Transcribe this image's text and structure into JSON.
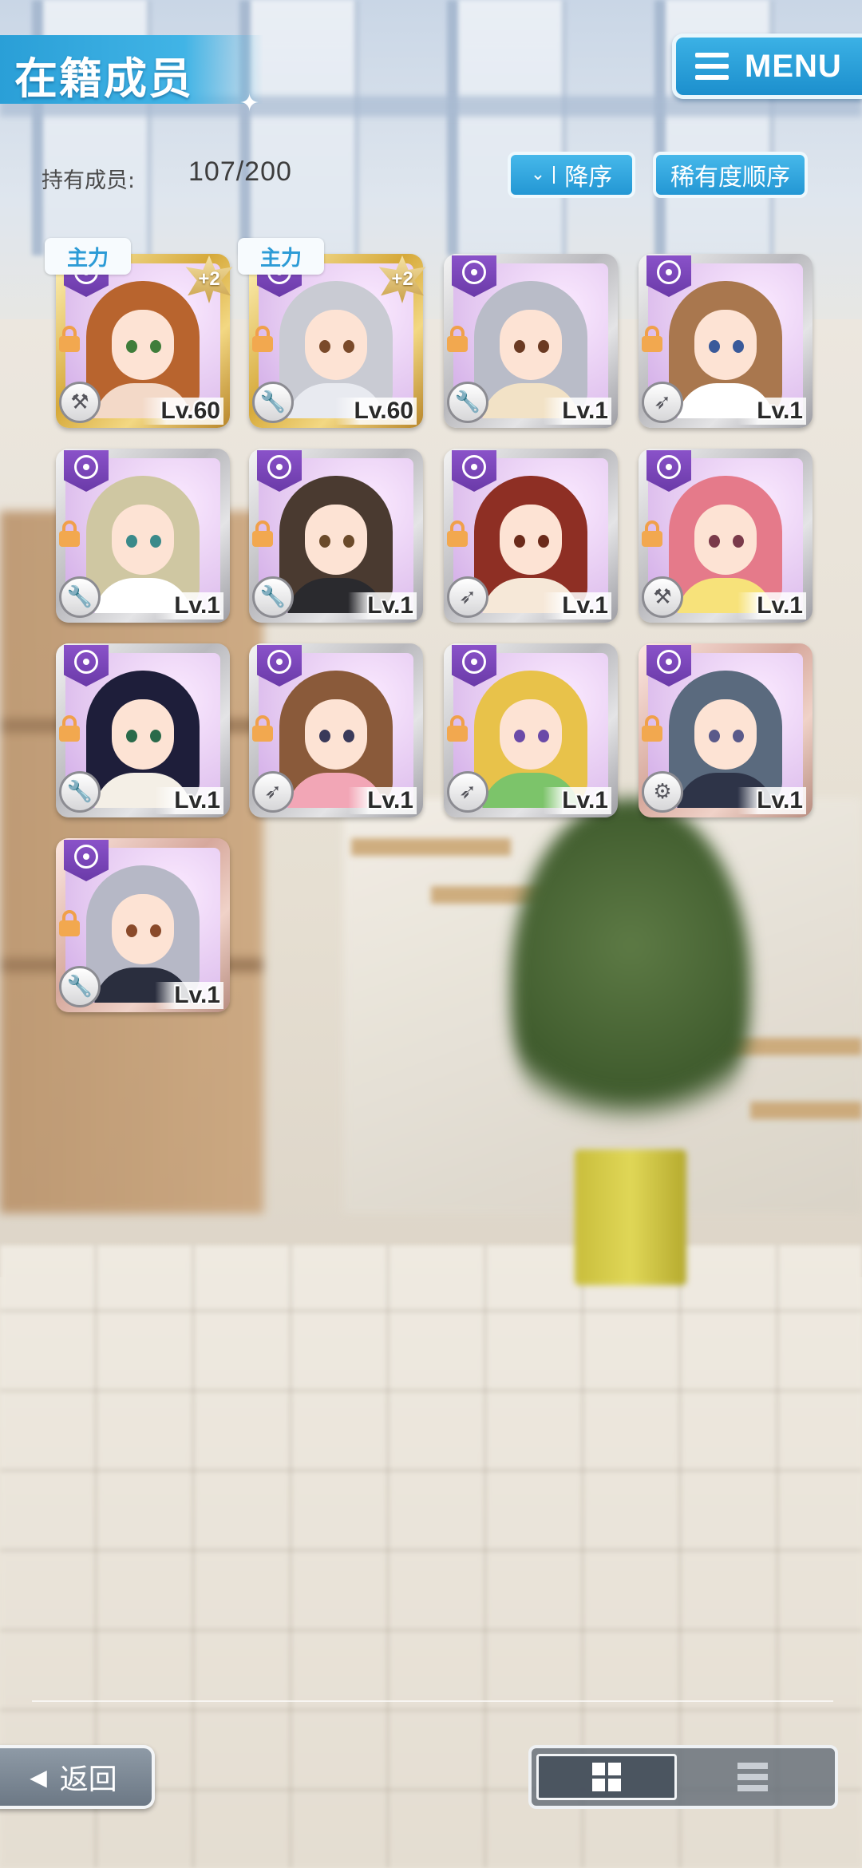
{
  "header": {
    "title": "在籍成员",
    "menu_label": "MENU",
    "menu_icon": "hamburger-icon"
  },
  "member_count": {
    "label": "持有成员:",
    "value": "107/200"
  },
  "sort": {
    "order_label": "降序",
    "order_icon": "double-chevron-down-icon",
    "rarity_label": "稀有度顺序"
  },
  "colors": {
    "accent_blue": "#2a9fd7",
    "attribute_purple": "#7a44b8",
    "lock_orange": "#f2a84f"
  },
  "members": [
    {
      "level": "Lv.60",
      "tag": "主力",
      "plus": "+2",
      "frame": "gold",
      "type_icon": "hammer-icon",
      "hair": "#b8642e",
      "body": "#f3d9c8",
      "eye": "#3f7d3a"
    },
    {
      "level": "Lv.60",
      "tag": "主力",
      "plus": "+2",
      "frame": "gold",
      "type_icon": "wrench-icon",
      "hair": "#c9cbd3",
      "body": "#e8eaf0",
      "eye": "#7a4a2a"
    },
    {
      "level": "Lv.1",
      "tag": "",
      "plus": "",
      "frame": "silver",
      "type_icon": "wrench-icon",
      "hair": "#b9bcc8",
      "body": "#f2e2c6",
      "eye": "#6b3a22"
    },
    {
      "level": "Lv.1",
      "tag": "",
      "plus": "",
      "frame": "silver",
      "type_icon": "rocket-icon",
      "hair": "#a9774e",
      "body": "#ffffff",
      "eye": "#3a5a9a"
    },
    {
      "level": "Lv.1",
      "tag": "",
      "plus": "",
      "frame": "silver",
      "type_icon": "wrench-icon",
      "hair": "#cfc7a2",
      "body": "#ffffff",
      "eye": "#3a8a8a"
    },
    {
      "level": "Lv.1",
      "tag": "",
      "plus": "",
      "frame": "silver",
      "type_icon": "wrench-icon",
      "hair": "#4a3a30",
      "body": "#2a2a2e",
      "eye": "#6b4a2a"
    },
    {
      "level": "Lv.1",
      "tag": "",
      "plus": "",
      "frame": "silver",
      "type_icon": "rocket-icon",
      "hair": "#8e2f24",
      "body": "#f6e8d8",
      "eye": "#6b2a1a"
    },
    {
      "level": "Lv.1",
      "tag": "",
      "plus": "",
      "frame": "silver",
      "type_icon": "hammer-icon",
      "hair": "#e57a8a",
      "body": "#f7e27a",
      "eye": "#7a3a4a"
    },
    {
      "level": "Lv.1",
      "tag": "",
      "plus": "",
      "frame": "silver",
      "type_icon": "wrench-icon",
      "hair": "#1e1e3a",
      "body": "#f4efe6",
      "eye": "#2a6a4a"
    },
    {
      "level": "Lv.1",
      "tag": "",
      "plus": "",
      "frame": "silver",
      "type_icon": "rocket-icon",
      "hair": "#8a5a3a",
      "body": "#f2a6b6",
      "eye": "#3a3a5a"
    },
    {
      "level": "Lv.1",
      "tag": "",
      "plus": "",
      "frame": "silver",
      "type_icon": "rocket-icon",
      "hair": "#e8c24a",
      "body": "#7cc46a",
      "eye": "#6a4aa8"
    },
    {
      "level": "Lv.1",
      "tag": "",
      "plus": "",
      "frame": "pink",
      "type_icon": "gear-icon",
      "hair": "#5a6a7e",
      "body": "#2e3448",
      "eye": "#5a5a8a"
    },
    {
      "level": "Lv.1",
      "tag": "",
      "plus": "",
      "frame": "pink",
      "type_icon": "wrench-icon",
      "hair": "#b6b8c6",
      "body": "#2a2e3e",
      "eye": "#8a4a2a"
    }
  ],
  "footer": {
    "back_label": "返回",
    "back_icon": "triangle-left-icon",
    "grid_view_icon": "grid-view-icon",
    "list_view_icon": "list-view-icon"
  }
}
